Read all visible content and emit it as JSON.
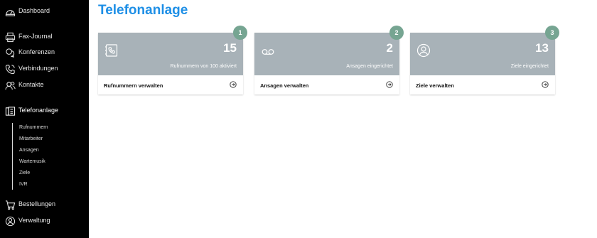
{
  "sidebar": {
    "items": [
      {
        "label": "Dashboard",
        "icon": "dashboard-icon"
      },
      {
        "label": "Fax-Journal",
        "icon": "fax-icon"
      },
      {
        "label": "Konferenzen",
        "icon": "conference-icon"
      },
      {
        "label": "Verbindungen",
        "icon": "phone-icon"
      },
      {
        "label": "Kontakte",
        "icon": "contacts-icon"
      },
      {
        "label": "Telefonanlage",
        "icon": "pbx-icon"
      },
      {
        "label": "Bestellungen",
        "icon": "cart-icon"
      },
      {
        "label": "Verwaltung",
        "icon": "admin-icon"
      }
    ],
    "active": "Telefonanlage",
    "subitems": [
      "Rufnummern",
      "Mitarbeiter",
      "Ansagen",
      "Wartemusik",
      "Ziele",
      "IVR"
    ]
  },
  "main": {
    "title": "Telefonanlage",
    "cards": [
      {
        "count": "15",
        "subtitle": "Rufnummern von 100 aktiviert",
        "link": "Rufnummern verwalten",
        "badge": "1",
        "icon": "phone-book-icon"
      },
      {
        "count": "2",
        "subtitle": "Ansagen eingerichtet",
        "link": "Ansagen verwalten",
        "badge": "2",
        "icon": "voicemail-icon"
      },
      {
        "count": "13",
        "subtitle": "Ziele eingerichtet",
        "link": "Ziele verwalten",
        "badge": "3",
        "icon": "user-icon"
      }
    ]
  },
  "colors": {
    "sidebar_bg": "#000000",
    "title": "#1e8fe6",
    "card_header": "#a8b2b8",
    "badge": "#76a592"
  }
}
